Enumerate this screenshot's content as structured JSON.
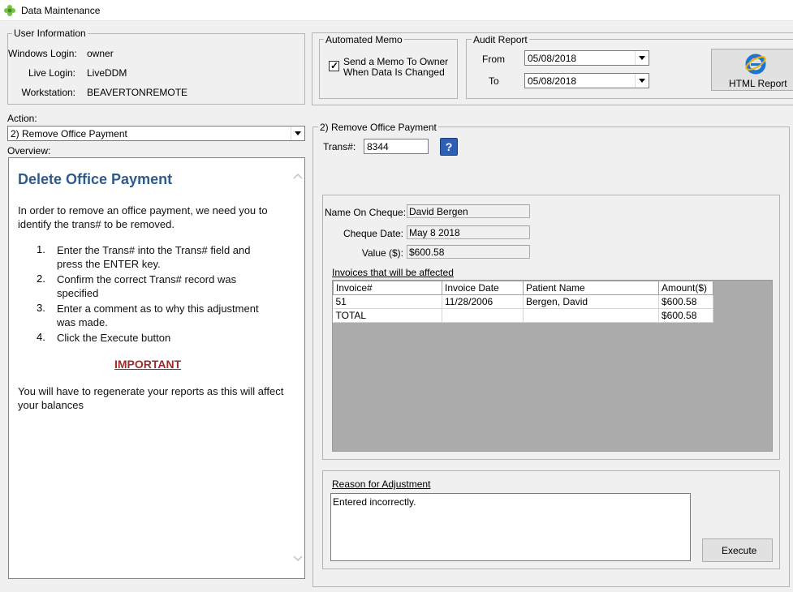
{
  "window": {
    "title": "Data Maintenance"
  },
  "user_info": {
    "legend": "User Information",
    "windows_login_label": "Windows Login:",
    "windows_login_value": "owner",
    "live_login_label": "Live Login:",
    "live_login_value": "LiveDDM",
    "workstation_label": "Workstation:",
    "workstation_value": "BEAVERTONREMOTE"
  },
  "automated_memo": {
    "legend": "Automated Memo",
    "checkbox_line1": "Send a Memo To Owner",
    "checkbox_line2": "When Data Is Changed",
    "checked": true
  },
  "audit_report": {
    "legend": "Audit Report",
    "from_label": "From",
    "from_value": "05/08/2018",
    "to_label": "To",
    "to_value": "05/08/2018",
    "html_report_label": "HTML Report"
  },
  "action": {
    "label": "Action:",
    "selected": "2) Remove Office Payment"
  },
  "overview": {
    "label": "Overview:",
    "title": "Delete Office Payment",
    "intro": "In order to remove an office payment, we need you to identify the trans# to be removed.",
    "steps": [
      {
        "num": "1.",
        "line1": "Enter the Trans# into the Trans# field and",
        "line2": "press the ENTER key."
      },
      {
        "num": "2.",
        "line1": "Confirm the correct Trans# record was",
        "line2": "specified"
      },
      {
        "num": "3.",
        "line1": "Enter a comment as to why this adjustment",
        "line2": "was made."
      },
      {
        "num": "4.",
        "line1": "Click the Execute button",
        "line2": ""
      }
    ],
    "important": "IMPORTANT",
    "footer": "You will have to regenerate your reports as this will affect your balances"
  },
  "remove_payment": {
    "legend": "2) Remove Office Payment",
    "trans_label": "Trans#:",
    "trans_value": "8344",
    "help_icon": "question-mark-icon",
    "name_label": "Name On Cheque:",
    "name_value": "David Bergen",
    "date_label": "Cheque Date:",
    "date_value": "May  8 2018",
    "value_label": "Value ($):",
    "value_value": "$600.58",
    "invoices_label": "Invoices that will be affected",
    "columns": [
      "Invoice#",
      "Invoice Date",
      "Patient Name",
      "Amount($)"
    ],
    "rows": [
      [
        "51",
        "11/28/2006",
        "Bergen, David",
        "$600.58"
      ],
      [
        "TOTAL",
        "",
        "",
        "$600.58"
      ]
    ],
    "reason_label": "Reason for Adjustment",
    "reason_value": "Entered incorrectly.",
    "execute_label": "Execute"
  }
}
